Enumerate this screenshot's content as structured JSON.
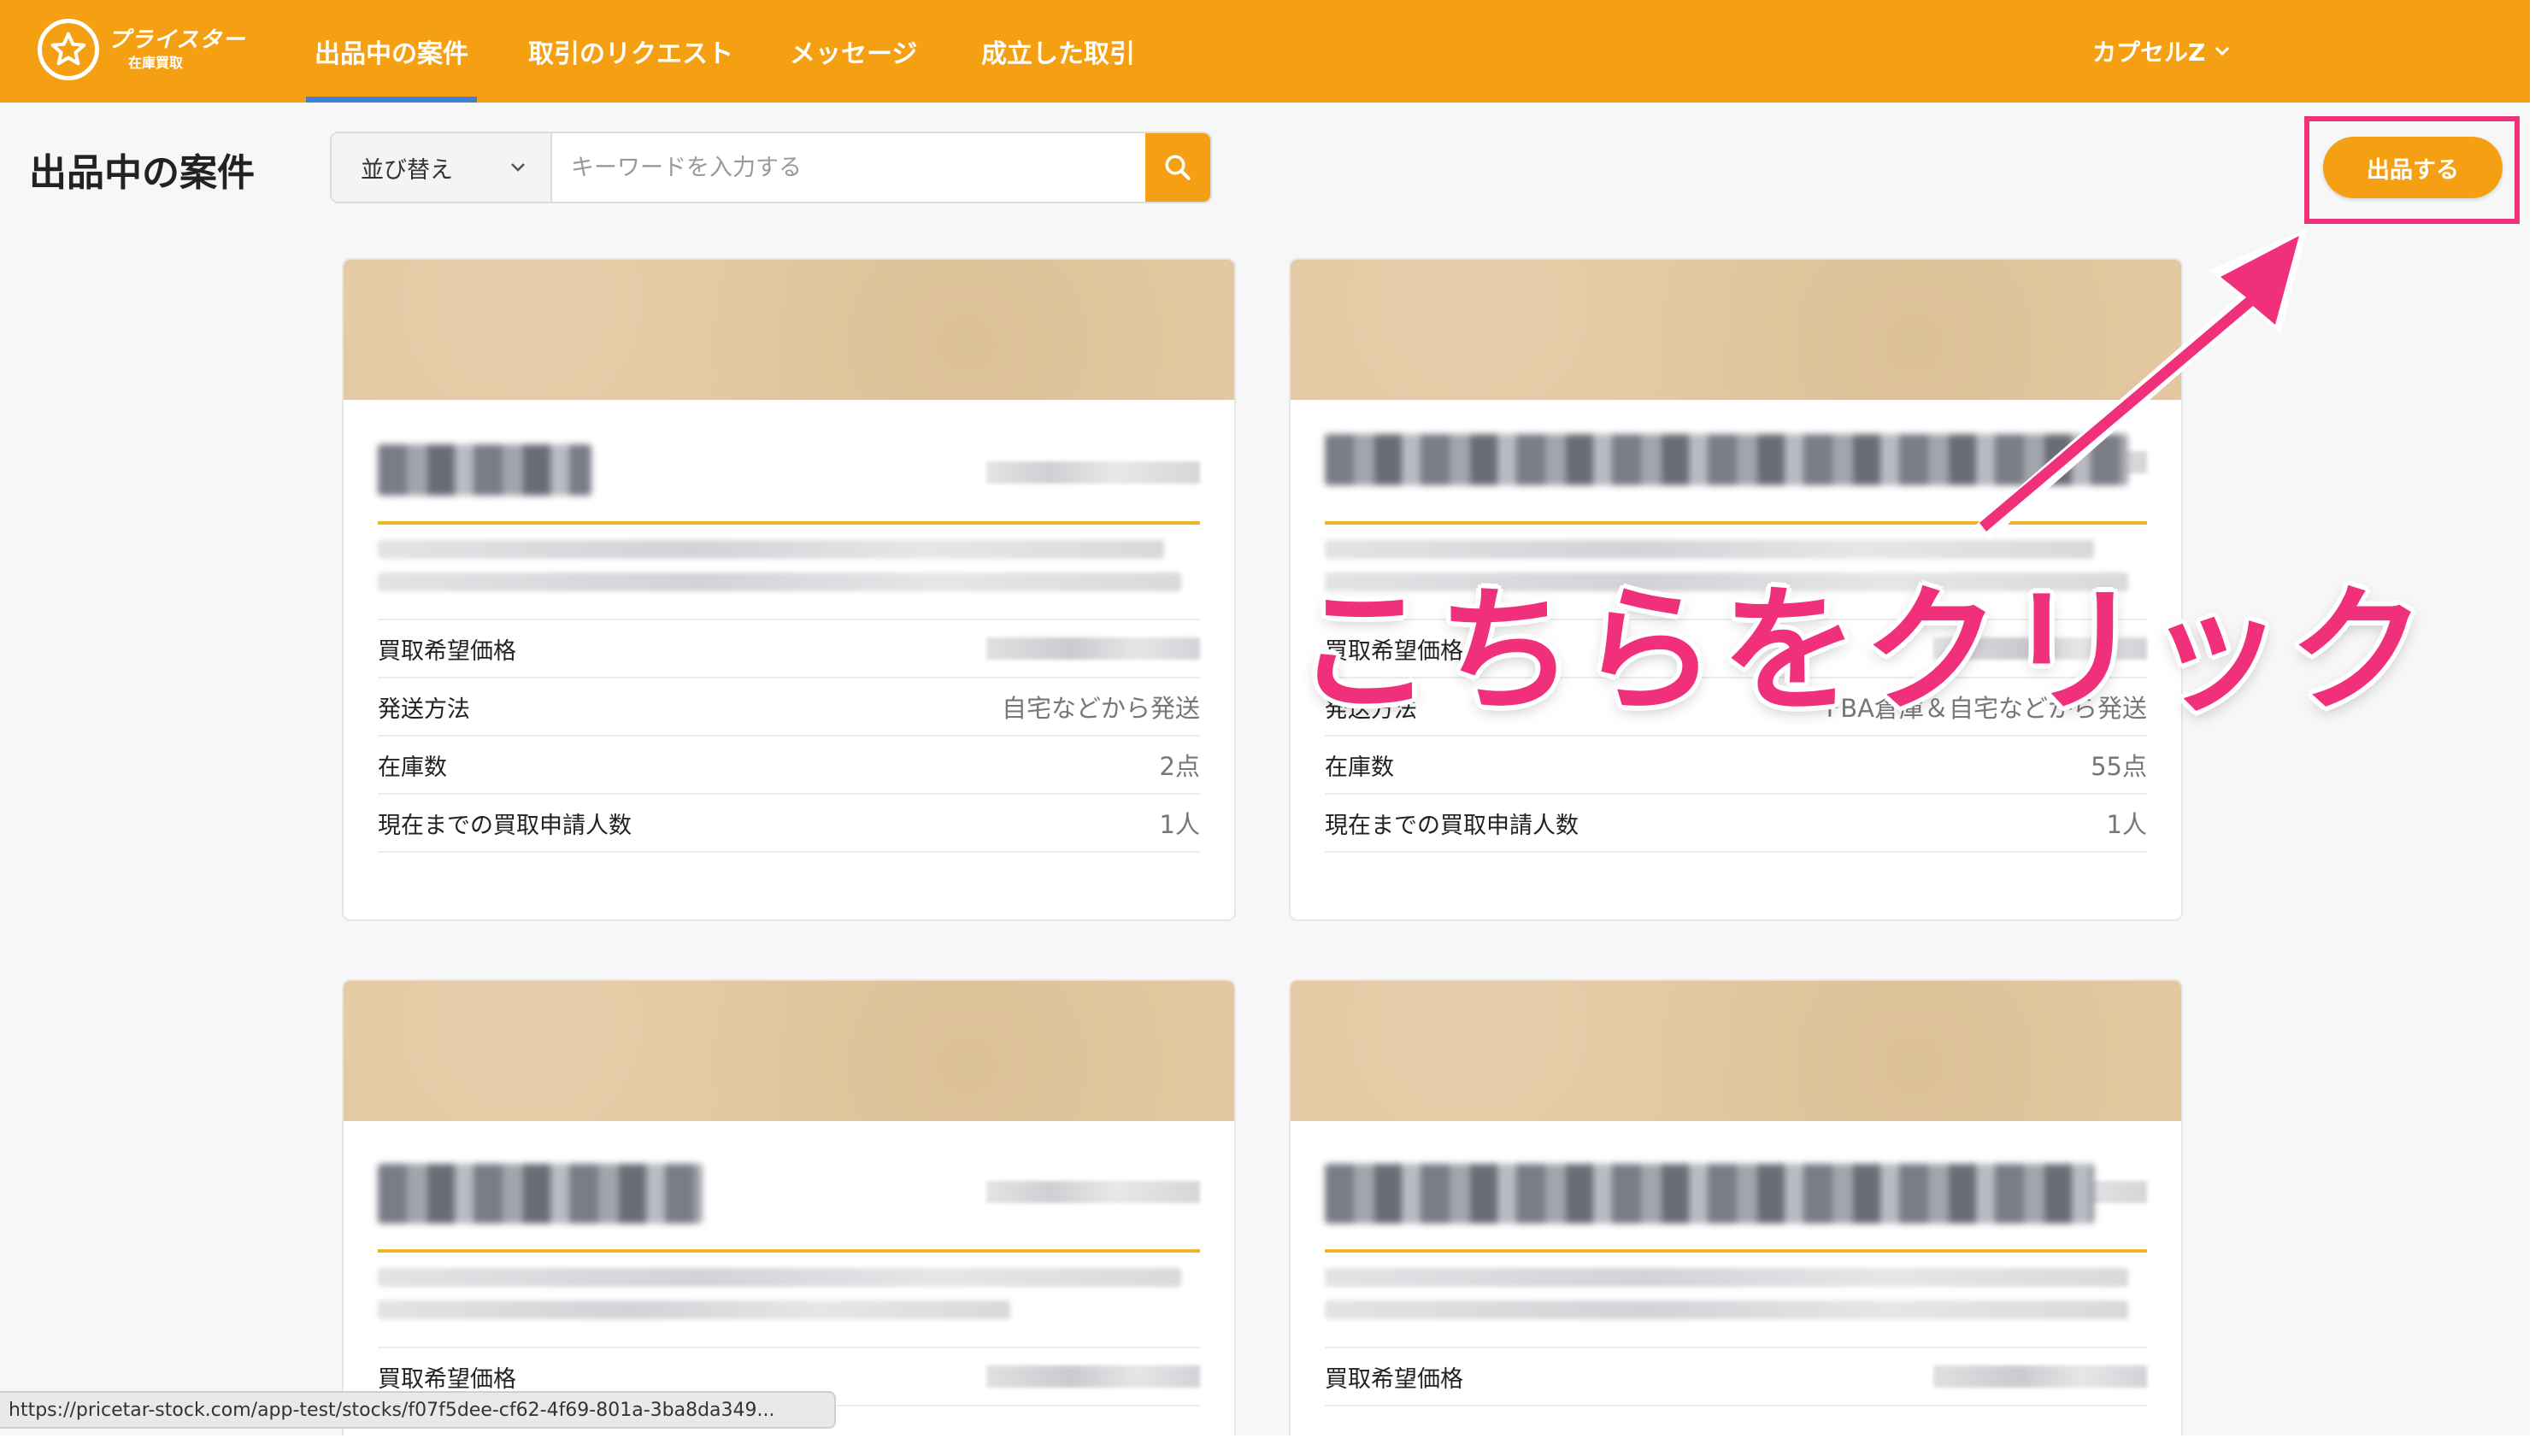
{
  "header": {
    "logo_main": "プライスター",
    "logo_sub": "在庫買取",
    "tabs": [
      {
        "label": "出品中の案件",
        "active": true
      },
      {
        "label": "取引のリクエスト",
        "active": false
      },
      {
        "label": "メッセージ",
        "active": false
      },
      {
        "label": "成立した取引",
        "active": false
      }
    ],
    "user_label": "カプセルZ"
  },
  "toolbar": {
    "page_title": "出品中の案件",
    "sort_label": "並び替え",
    "search_placeholder": "キーワードを入力する",
    "list_button": "出品する"
  },
  "cards": [
    {
      "rows": [
        {
          "label": "買取希望価格",
          "value": ""
        },
        {
          "label": "発送方法",
          "value": "自宅などから発送"
        },
        {
          "label": "在庫数",
          "value": "2点"
        },
        {
          "label": "現在までの買取申請人数",
          "value": "1人"
        }
      ]
    },
    {
      "rows": [
        {
          "label": "買取希望価格",
          "value": ""
        },
        {
          "label": "発送方法",
          "value": "FBA倉庫＆自宅などから発送"
        },
        {
          "label": "在庫数",
          "value": "55点"
        },
        {
          "label": "現在までの買取申請人数",
          "value": "1人"
        }
      ]
    },
    {
      "rows": [
        {
          "label": "買取希望価格",
          "value": ""
        }
      ]
    },
    {
      "rows": [
        {
          "label": "買取希望価格",
          "value": ""
        }
      ]
    }
  ],
  "status_url": "https://pricetar-stock.com/app-test/stocks/f07f5dee-cf62-4f69-801a-3ba8da349...",
  "annotation": "こちらをクリック",
  "colors": {
    "brand": "#f4a012",
    "active_tab_underline": "#3f7fd9",
    "annotation": "#f0307a",
    "card_divider": "#f0b429"
  }
}
